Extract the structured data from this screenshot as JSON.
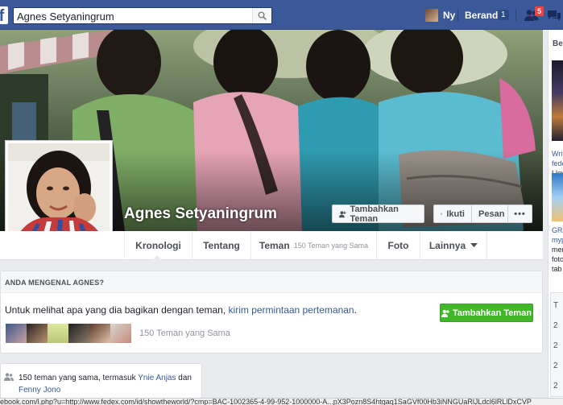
{
  "topbar": {
    "logo_letter": "f",
    "search_value": "Agnes Setyaningrum",
    "user_name": "Ny",
    "home_label": "Beranda",
    "home_count": "1",
    "friend_requests_count": "5"
  },
  "profile": {
    "name": "Agnes Setyaningrum",
    "buttons": {
      "add_friend": "Tambahkan Teman",
      "follow": "Ikuti",
      "message": "Pesan",
      "more": "•••"
    }
  },
  "nav": {
    "tabs": [
      {
        "label": "Kronologi"
      },
      {
        "label": "Tentang"
      },
      {
        "label": "Teman",
        "sub": "150 Teman yang Sama"
      },
      {
        "label": "Foto"
      },
      {
        "label": "Lainnya"
      }
    ]
  },
  "know_card": {
    "title": "ANDA MENGENAL AGNES?",
    "text_prefix": "Untuk melihat apa yang dia bagikan dengan teman, ",
    "link": "kirim permintaan pertemanan",
    "text_suffix": ".",
    "button": "Tambahkan Teman",
    "mutual_count": "150 Teman yang Sama"
  },
  "mutual_card": {
    "text_prefix": "150 teman yang sama, termasuk ",
    "friend1": "Ynie Anjas",
    "and": " dan",
    "friend2": "Fenny Jono"
  },
  "right_column": {
    "label": "Ber",
    "lines1": [
      "Writ",
      "fede",
      "Llev",
      "love"
    ],
    "lines2": [
      "GRA",
      "myp",
      "men",
      "foto",
      "tab"
    ],
    "box_lines": [
      "T",
      "2",
      "2",
      "2",
      "2",
      "2"
    ]
  },
  "statusbar": {
    "url": "ebook.com/l.php?u=http://www.fedex.com/id/showtheworld/?cmp=BAC-1002365-4-99-952-1000000-A...pX3Pozn8S4htgaq1SaGVf00Hb3iNNGUaRlJLdcl6lRLlDxCVP"
  },
  "colors": {
    "brand": "#3b5998",
    "link": "#365899",
    "green_button": "#42b72a",
    "badge": "#fa3e3e"
  }
}
